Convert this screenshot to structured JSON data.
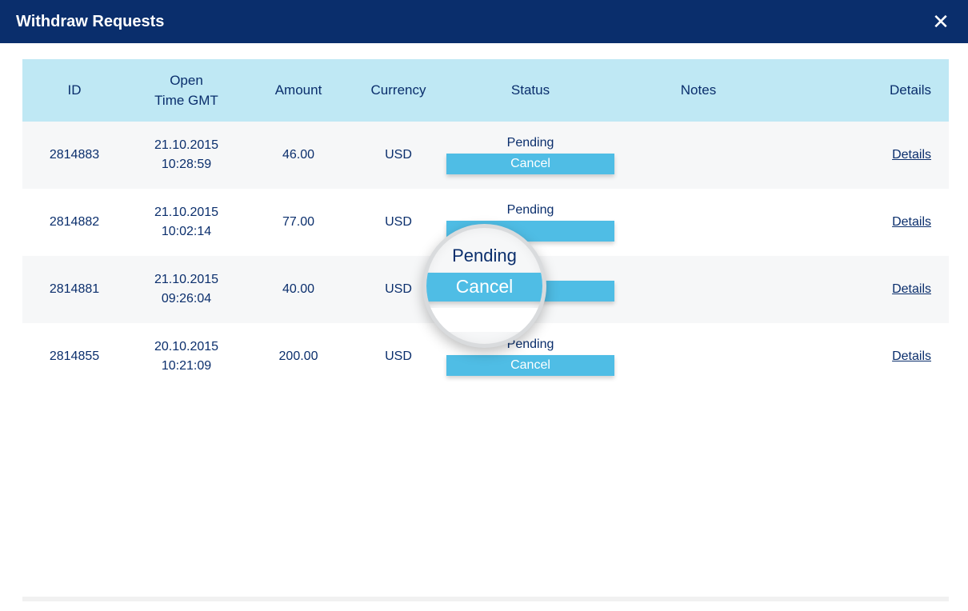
{
  "window": {
    "title": "Withdraw Requests",
    "close_icon": "✕"
  },
  "table": {
    "headers": {
      "id": "ID",
      "open_time_line1": "Open",
      "open_time_line2": "Time GMT",
      "amount": "Amount",
      "currency": "Currency",
      "status": "Status",
      "notes": "Notes",
      "details": "Details"
    },
    "rows": [
      {
        "id": "2814883",
        "date_line1": "21.10.2015",
        "date_line2": "10:28:59",
        "amount": "46.00",
        "currency": "USD",
        "status": "Pending",
        "cancel_label": "Cancel",
        "notes": "",
        "details_label": "Details"
      },
      {
        "id": "2814882",
        "date_line1": "21.10.2015",
        "date_line2": "10:02:14",
        "amount": "77.00",
        "currency": "USD",
        "status": "Pending",
        "cancel_label": "",
        "notes": "",
        "details_label": "Details"
      },
      {
        "id": "2814881",
        "date_line1": "21.10.2015",
        "date_line2": "09:26:04",
        "amount": "40.00",
        "currency": "USD",
        "status": "",
        "cancel_label": "",
        "notes": "",
        "details_label": "Details"
      },
      {
        "id": "2814855",
        "date_line1": "20.10.2015",
        "date_line2": "10:21:09",
        "amount": "200.00",
        "currency": "USD",
        "status": "Pending",
        "cancel_label": "Cancel",
        "notes": "",
        "details_label": "Details"
      }
    ]
  },
  "lens": {
    "status": "Pending",
    "cancel_label": "Cancel"
  }
}
